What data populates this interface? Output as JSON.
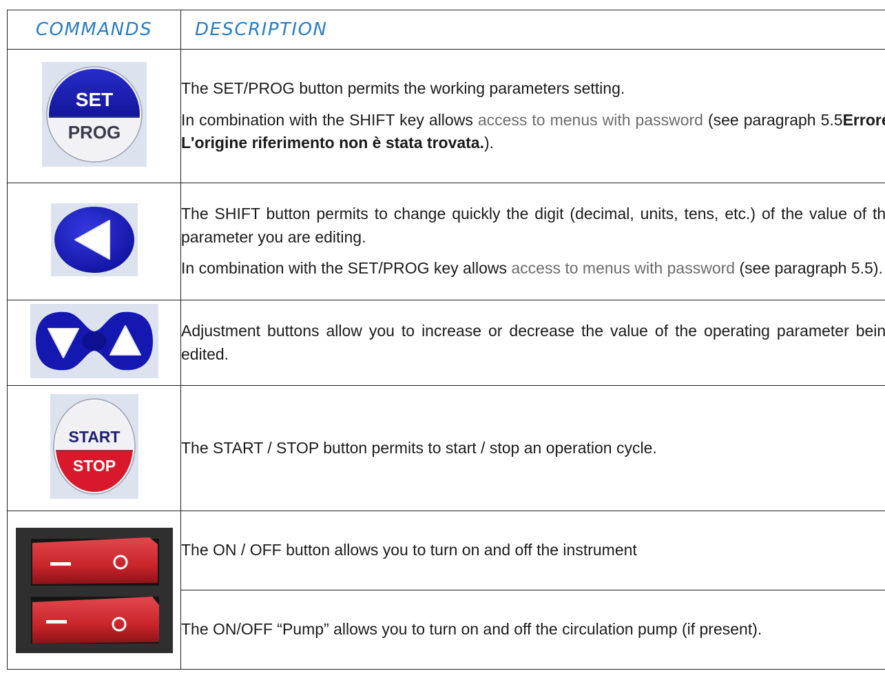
{
  "header": {
    "commands": "COMMANDS",
    "description": "DESCRIPTION"
  },
  "rows": {
    "setprog": {
      "icon": "set-prog-button-icon",
      "icon_top": "SET",
      "icon_bottom": "PROG",
      "p1": "The SET/PROG button permits the working parameters setting.",
      "p2_a": "In combination with the SHIFT key allows ",
      "p2_link": "access to menus with password",
      "p2_b": " (see paragraph 5.5",
      "p2_bold": "Errore. L'origine riferimento non è stata trovata.",
      "p2_c": ")."
    },
    "shift": {
      "icon": "shift-left-arrow-button-icon",
      "p1": "The SHIFT button permits to change quickly the digit (decimal, units, tens, etc.) of the value of the parameter you are editing.",
      "p2_a": "In combination with the SET/PROG key allows ",
      "p2_link": "access to menus with password",
      "p2_b": " (see paragraph 5.5)."
    },
    "adjust": {
      "icon": "up-down-adjustment-buttons-icon",
      "p1": "Adjustment buttons allow you to increase or decrease the value of the operating parameter being edited."
    },
    "startstop": {
      "icon": "start-stop-button-icon",
      "icon_top": "START",
      "icon_bottom": "STOP",
      "p1": "The START / STOP button permits to start / stop an operation cycle."
    },
    "onoff": {
      "icon": "rocker-switches-icon",
      "p1": "The ON / OFF button allows you to turn on and off the instrument"
    },
    "pump": {
      "p1": "The ON/OFF “Pump” allows you to turn on and off the circulation pump (if present)."
    }
  },
  "colors": {
    "header_text": "#2a7cc4",
    "button_blue": "#1a1fb8",
    "button_red": "#d8192c",
    "switch_red": "#c9252b"
  }
}
